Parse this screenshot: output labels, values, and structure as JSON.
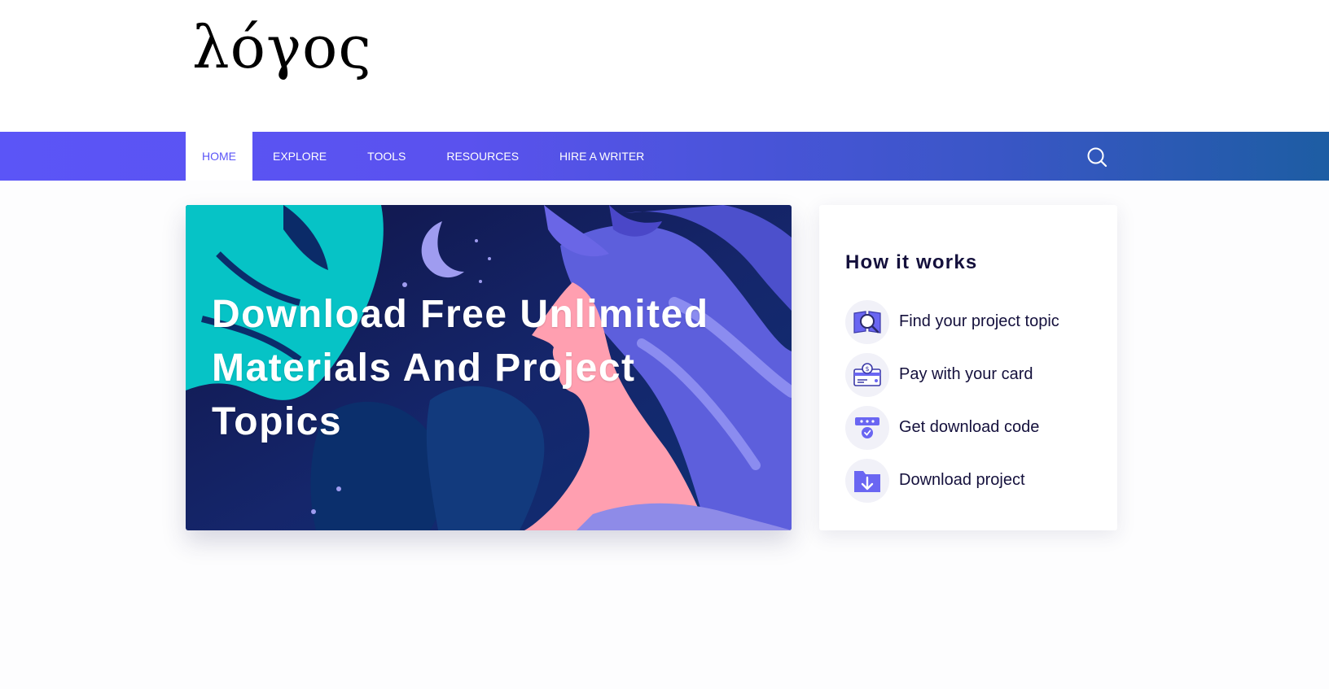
{
  "brand": {
    "logo_text": "λόγος"
  },
  "nav": {
    "items": [
      {
        "label": "HOME",
        "active": true
      },
      {
        "label": "EXPLORE"
      },
      {
        "label": "TOOLS"
      },
      {
        "label": "RESOURCES"
      },
      {
        "label": "HIRE A WRITER"
      }
    ],
    "search_icon": "search-icon"
  },
  "hero": {
    "title": "Download Free Unlimited Materials And Project Topics"
  },
  "how_it_works": {
    "title": "How it works",
    "steps": [
      {
        "label": "Find your project topic",
        "icon": "book-search-icon"
      },
      {
        "label": "Pay with your card",
        "icon": "credit-card-icon"
      },
      {
        "label": "Get download code",
        "icon": "code-badge-icon"
      },
      {
        "label": "Download project",
        "icon": "download-folder-icon"
      }
    ]
  },
  "colors": {
    "accent": "#5b55f7",
    "nav_gradient_end": "#1d5da3",
    "heading": "#14103c"
  }
}
